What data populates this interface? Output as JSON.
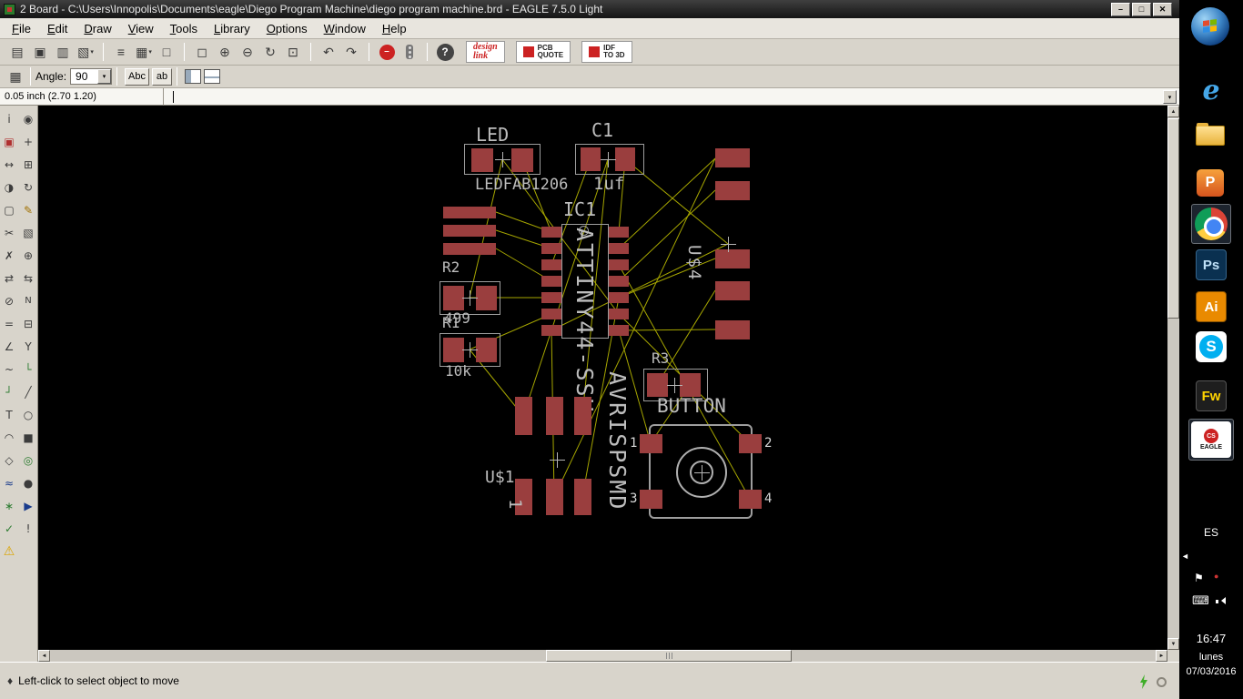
{
  "window": {
    "title": "2 Board - C:\\Users\\Innopolis\\Documents\\eagle\\Diego Program Machine\\diego program machine.brd - EAGLE 7.5.0 Light",
    "minimize": "–",
    "maximize": "□",
    "close": "✕"
  },
  "menu": {
    "items": [
      "File",
      "Edit",
      "Draw",
      "View",
      "Tools",
      "Library",
      "Options",
      "Window",
      "Help"
    ]
  },
  "ui": {
    "caret": "▾",
    "up": "▲",
    "down": "▼",
    "left": "◄",
    "right": "►"
  },
  "toolbar": {
    "icons": {
      "switch": "▤",
      "save": "▣",
      "print": "▥",
      "cam": "▧",
      "script": "≡",
      "layers": "▦",
      "blank": "□",
      "zoom_fit": "◻",
      "zoom_in": "⊕",
      "zoom_out": "⊖",
      "zoom_redraw": "↻",
      "zoom_select": "⊡",
      "undo": "↶",
      "redo": "↷",
      "stop": "–",
      "help": "?"
    },
    "promos": [
      {
        "line1": "design",
        "line2": "link"
      },
      {
        "line1": "PCB",
        "line2": "QUOTE"
      },
      {
        "line1": "IDF",
        "line2": "TO 3D"
      }
    ]
  },
  "params": {
    "grid": "▦",
    "angle_label": "Angle:",
    "angle_value": "90",
    "abc": "Abc",
    "text2": "ab"
  },
  "command": {
    "position": "0.05 inch (2.70 1.20)"
  },
  "palette": {
    "items": [
      {
        "name": "info",
        "glyph": "i"
      },
      {
        "name": "show",
        "glyph": "◉"
      },
      {
        "name": "display",
        "glyph": "▣"
      },
      {
        "name": "mark",
        "glyph": "+"
      },
      {
        "name": "move",
        "glyph": "↔"
      },
      {
        "name": "copy",
        "glyph": "⊞"
      },
      {
        "name": "mirror",
        "glyph": "◑"
      },
      {
        "name": "rotate",
        "glyph": "↻"
      },
      {
        "name": "group",
        "glyph": "▢"
      },
      {
        "name": "change",
        "glyph": "✎"
      },
      {
        "name": "cut",
        "glyph": "✂"
      },
      {
        "name": "paste",
        "glyph": "▧"
      },
      {
        "name": "delete",
        "glyph": "✗"
      },
      {
        "name": "add",
        "glyph": "⊕"
      },
      {
        "name": "pinswap",
        "glyph": "⇄"
      },
      {
        "name": "replace",
        "glyph": "⇆"
      },
      {
        "name": "lock",
        "glyph": "⊘"
      },
      {
        "name": "name",
        "glyph": "N"
      },
      {
        "name": "value",
        "glyph": "="
      },
      {
        "name": "smash",
        "glyph": "⊟"
      },
      {
        "name": "miter",
        "glyph": "∠"
      },
      {
        "name": "split",
        "glyph": "Y"
      },
      {
        "name": "optimize",
        "glyph": "~"
      },
      {
        "name": "route",
        "glyph": "└"
      },
      {
        "name": "ripup",
        "glyph": "┘"
      },
      {
        "name": "wire",
        "glyph": "╱"
      },
      {
        "name": "text",
        "glyph": "T"
      },
      {
        "name": "circle",
        "glyph": "○"
      },
      {
        "name": "arc",
        "glyph": "◠"
      },
      {
        "name": "rect",
        "glyph": "■"
      },
      {
        "name": "polygon",
        "glyph": "◇"
      },
      {
        "name": "via",
        "glyph": "◎"
      },
      {
        "name": "signal",
        "glyph": "≈"
      },
      {
        "name": "hole",
        "glyph": "●"
      },
      {
        "name": "ratsnest",
        "glyph": "∗"
      },
      {
        "name": "auto",
        "glyph": "▶"
      },
      {
        "name": "drc",
        "glyph": "✓"
      },
      {
        "name": "errors",
        "glyph": "!"
      },
      {
        "name": "warning",
        "glyph": "⚠"
      }
    ]
  },
  "board": {
    "led": {
      "name": "LED",
      "value": "LEDFAB1206"
    },
    "c1": {
      "name": "C1",
      "value": "1uf"
    },
    "ic1": {
      "name": "IC1",
      "value": "ATTINY44-SSU"
    },
    "r2": {
      "name": "R2",
      "value": "499"
    },
    "r1": {
      "name": "R1",
      "value": "10k"
    },
    "r3": {
      "name": "R3"
    },
    "u4": {
      "name": "U$4"
    },
    "u1": {
      "name": "U$1",
      "value": "AVRISPSMD",
      "pin1": "1"
    },
    "button": {
      "name": "BUTTON",
      "p1": "1",
      "p2": "2",
      "p3": "3",
      "p4": "4"
    },
    "colors": {
      "pad": "#9a3e3e",
      "ratsnest": "#c6c600",
      "silkscreen": "#b5b5b5",
      "background": "#000000"
    }
  },
  "status": {
    "bullet": "♦",
    "message": "Left-click to select object to move"
  },
  "taskbar": {
    "apps": {
      "ie": "e",
      "office": "P",
      "photoshop": "Ps",
      "illustrator": "Ai",
      "skype": "S",
      "fireworks": "Fw",
      "eagle_cs": "CS",
      "eagle": "EAGLE"
    },
    "tray": {
      "language": "ES",
      "flag": "⚑",
      "dot": "●",
      "keyboard": "⌨"
    },
    "clock": {
      "time": "16:47",
      "day": "lunes",
      "date": "07/03/2016"
    }
  }
}
